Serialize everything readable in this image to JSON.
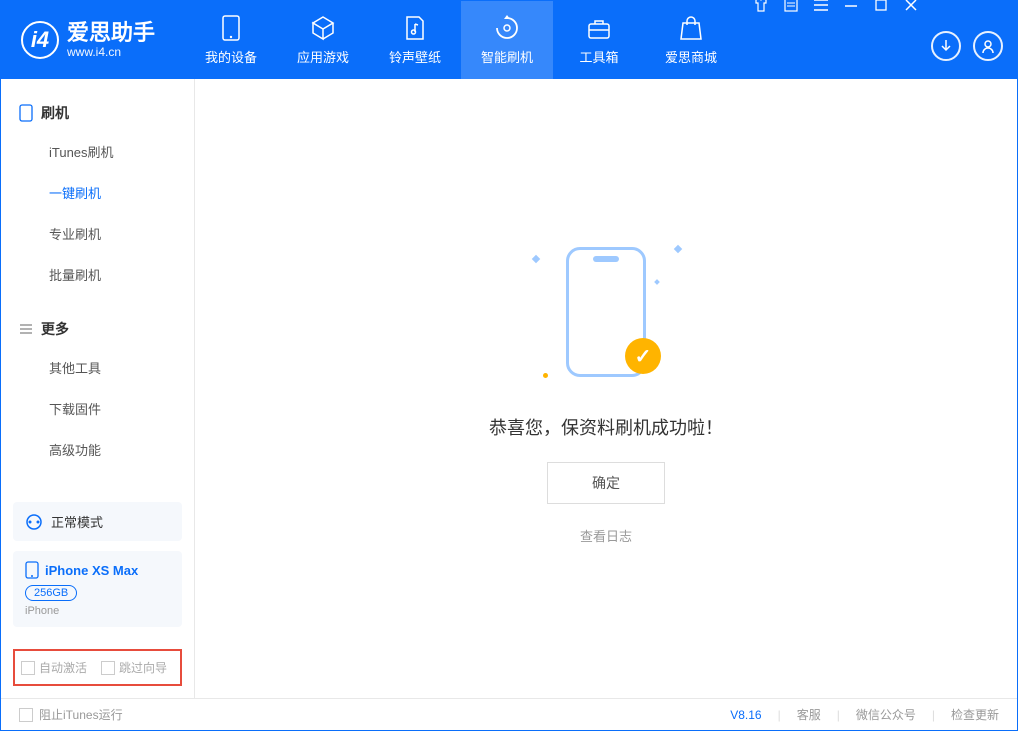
{
  "app": {
    "title": "爱思助手",
    "subtitle": "www.i4.cn"
  },
  "tabs": [
    {
      "label": "我的设备"
    },
    {
      "label": "应用游戏"
    },
    {
      "label": "铃声壁纸"
    },
    {
      "label": "智能刷机"
    },
    {
      "label": "工具箱"
    },
    {
      "label": "爱思商城"
    }
  ],
  "sidebar": {
    "section1": {
      "title": "刷机",
      "items": [
        {
          "label": "iTunes刷机"
        },
        {
          "label": "一键刷机"
        },
        {
          "label": "专业刷机"
        },
        {
          "label": "批量刷机"
        }
      ]
    },
    "section2": {
      "title": "更多",
      "items": [
        {
          "label": "其他工具"
        },
        {
          "label": "下载固件"
        },
        {
          "label": "高级功能"
        }
      ]
    }
  },
  "device": {
    "mode": "正常模式",
    "name": "iPhone XS Max",
    "capacity": "256GB",
    "type": "iPhone"
  },
  "checks": {
    "auto_activate": "自动激活",
    "skip_guide": "跳过向导"
  },
  "main": {
    "message": "恭喜您，保资料刷机成功啦！",
    "ok": "确定",
    "view_log": "查看日志"
  },
  "statusbar": {
    "block_itunes": "阻止iTunes运行",
    "version": "V8.16",
    "support": "客服",
    "wechat": "微信公众号",
    "update": "检查更新"
  }
}
